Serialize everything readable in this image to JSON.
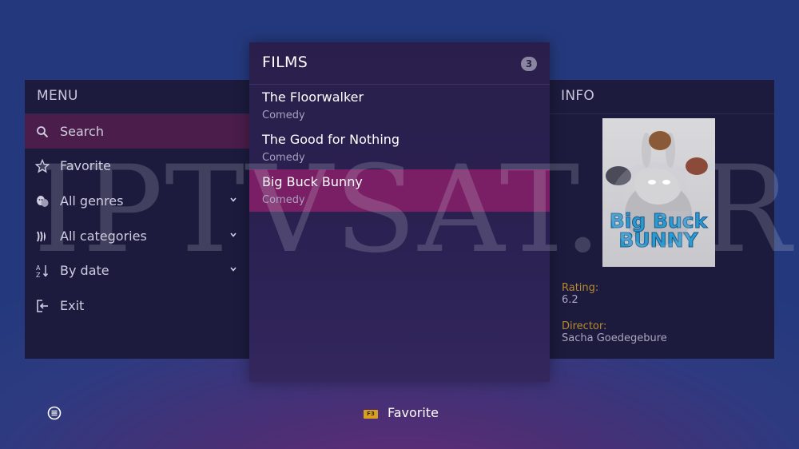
{
  "menu": {
    "title": "MENU",
    "items": [
      {
        "label": "Search",
        "icon": "search-icon",
        "active": true
      },
      {
        "label": "Favorite",
        "icon": "star-icon"
      },
      {
        "label": "All genres",
        "icon": "theater-masks-icon",
        "expandable": true
      },
      {
        "label": "All categories",
        "icon": "categories-icon",
        "expandable": true
      },
      {
        "label": "By date",
        "icon": "sort-az-icon",
        "expandable": true
      },
      {
        "label": "Exit",
        "icon": "exit-icon"
      }
    ]
  },
  "films": {
    "title": "FILMS",
    "count": "3",
    "items": [
      {
        "title": "The Floorwalker",
        "genre": "Comedy"
      },
      {
        "title": "The Good for Nothing",
        "genre": "Comedy"
      },
      {
        "title": "Big Buck Bunny",
        "genre": "Comedy",
        "active": true
      }
    ]
  },
  "info": {
    "title": "INFO",
    "poster_text": [
      "Big Buck",
      "BUNNY"
    ],
    "rating_label": "Rating:",
    "rating_value": "6.2",
    "director_label": "Director:",
    "director_value": "Sacha Goedegebure"
  },
  "watermark": "IPTVSAT.GR",
  "bottom_bar": {
    "key_label": "F3",
    "action_label": "Favorite"
  },
  "colors": {
    "accent_active_film": "#7a1f66",
    "accent_active_menu": "#4a1d4a",
    "label_gold": "#b88a2c",
    "key_yellow": "#d8a020"
  }
}
